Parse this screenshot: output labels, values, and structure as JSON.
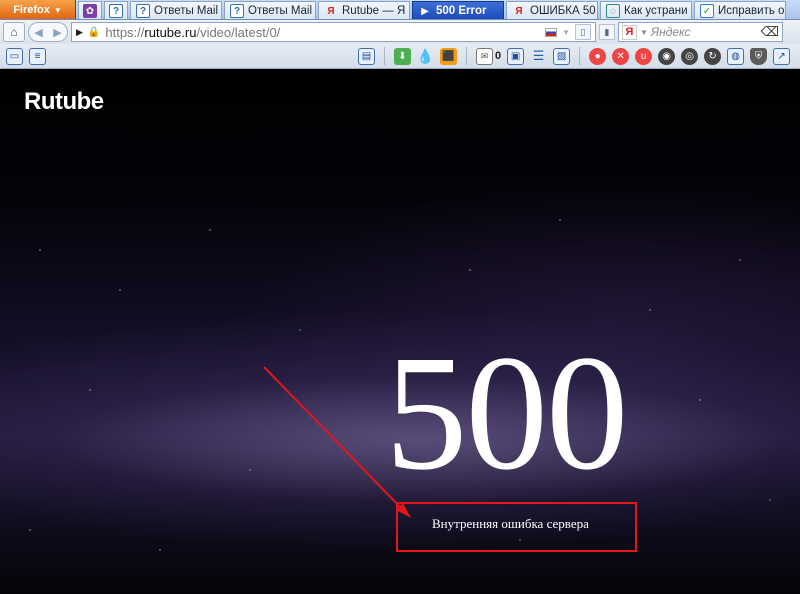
{
  "browser": {
    "menu_button_label": "Firefox",
    "tabs": [
      {
        "label": "",
        "icon": "purple-app-icon",
        "pinned": true
      },
      {
        "label": "",
        "icon": "question-icon",
        "pinned": true
      },
      {
        "label": "Ответы Mail",
        "icon": "question-icon"
      },
      {
        "label": "Ответы Mail",
        "icon": "question-icon"
      },
      {
        "label": "Rutube — Я",
        "icon": "yandex-icon"
      },
      {
        "label": "500 Error",
        "icon": "play-icon",
        "active": true
      },
      {
        "label": "ОШИБКА 50",
        "icon": "yandex-icon"
      },
      {
        "label": "Как устрани",
        "icon": "globe-icon"
      },
      {
        "label": "Исправить о",
        "icon": "check-icon"
      }
    ]
  },
  "address_bar": {
    "protocol": "https://",
    "host": "rutube.ru",
    "path": "/video/latest/0/"
  },
  "search_bar": {
    "engine_icon": "Я",
    "placeholder": "Яндекс"
  },
  "toolbar": {
    "mail_count": "0"
  },
  "page": {
    "logo_text": "Rutube",
    "error_code": "500",
    "error_message": "Внутренняя ошибка сервера"
  },
  "annotation": {
    "color": "#e3161b"
  }
}
